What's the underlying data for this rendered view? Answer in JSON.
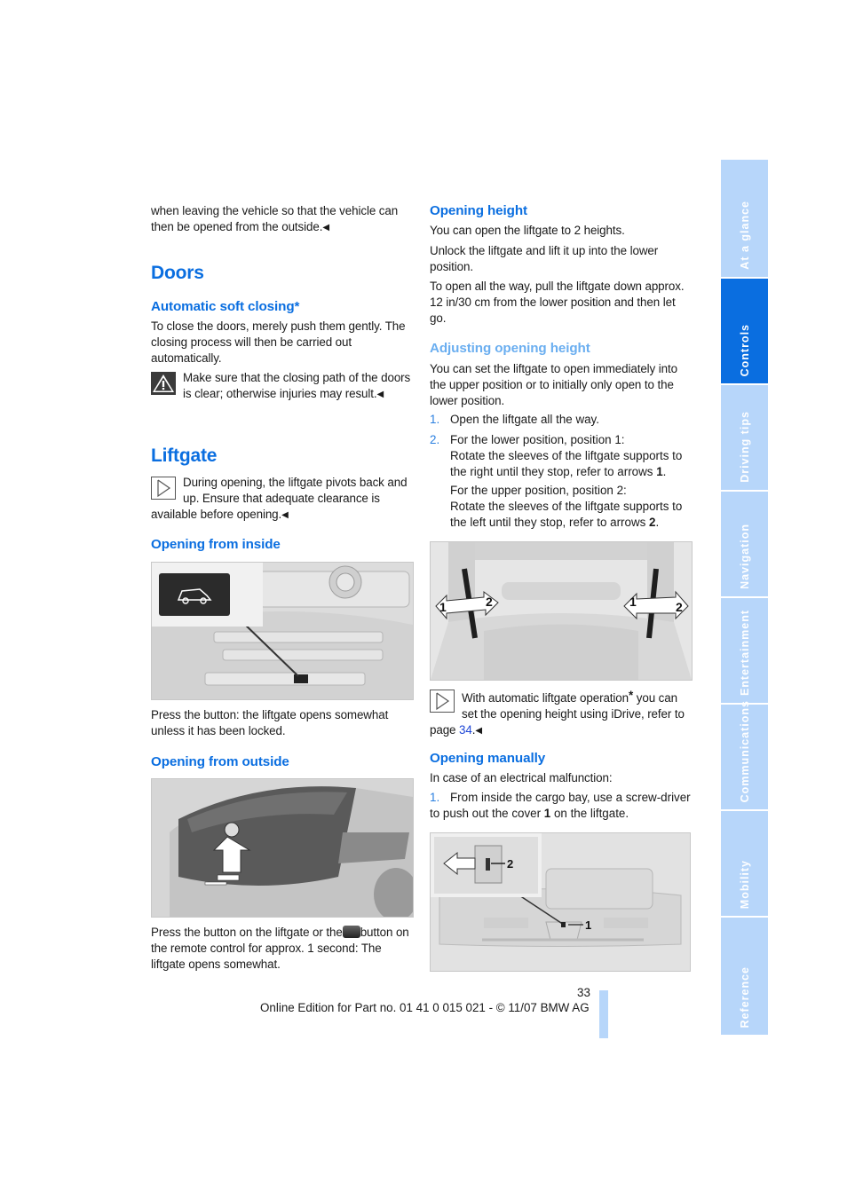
{
  "left_column": {
    "intro_text": "when leaving the vehicle so that the vehicle can then be opened from the outside.",
    "doors": {
      "title": "Doors",
      "auto_soft_closing": {
        "title": "Automatic soft closing*",
        "body": "To close the doors, merely push them gently. The closing process will then be carried out automatically.",
        "warning_icon": "warning-triangle-icon",
        "warning": "Make sure that the closing path of the doors is clear; otherwise injuries may result."
      }
    },
    "liftgate": {
      "title": "Liftgate",
      "note_icon": "note-arrow-icon",
      "note": "During opening, the liftgate pivots back and up. Ensure that adequate clearance is available before opening.",
      "opening_from_inside": {
        "title": "Opening from inside",
        "figure_alt": "Center console with liftgate button highlighted",
        "body": "Press the button: the liftgate opens somewhat unless it has been locked."
      },
      "opening_from_outside": {
        "title": "Opening from outside",
        "figure_alt": "Rear of vehicle with arrow pointing to button on liftgate",
        "body_part1": "Press the button on the liftgate or the",
        "remote_button_icon": "remote-liftgate-button-icon",
        "body_part2": "button on the remote control for approx. 1 second: The liftgate opens somewhat."
      }
    }
  },
  "right_column": {
    "opening_height": {
      "title": "Opening height",
      "p1": "You can open the liftgate to 2 heights.",
      "p2": "Unlock the liftgate and lift it up into the lower position.",
      "p3": "To open all the way, pull the liftgate down approx. 12 in/30 cm from the lower position and then let go."
    },
    "adjusting_opening_height": {
      "title": "Adjusting opening height",
      "body": "You can set the liftgate to open immediately into the upper position or to initially only open to the lower position.",
      "steps": [
        {
          "num": "1.",
          "text": "Open the liftgate all the way."
        },
        {
          "num": "2.",
          "text_a": "For the lower position, position 1:",
          "text_b": "Rotate the sleeves of the liftgate supports to the right until they stop, refer to arrows ",
          "bold_b": "1",
          "text_c": "For the upper position, position 2:",
          "text_d": "Rotate the sleeves of the liftgate supports to the left until they stop, refer to arrows ",
          "bold_d": "2"
        }
      ],
      "figure_alt": "Open liftgate with support struts and rotation arrows",
      "figure_labels": [
        "1",
        "2",
        "1",
        "2"
      ],
      "note_icon": "note-arrow-icon",
      "note_part1": "With automatic liftgate operation",
      "note_asterisk": "*",
      "note_part2": " you can set the opening height using iDrive, refer to page ",
      "note_link": "34"
    },
    "opening_manually": {
      "title": "Opening manually",
      "body": "In case of an electrical malfunction:",
      "steps": [
        {
          "num": "1.",
          "text": "From inside the cargo bay, use a screw-driver to push out the cover ",
          "bold": "1",
          "text_end": " on the liftgate."
        }
      ],
      "figure_alt": "Cargo bay liftgate cover detail",
      "figure_labels": [
        "2",
        "1"
      ]
    }
  },
  "footer": {
    "page_number": "33",
    "edition": "Online Edition for Part no. 01 41 0 015 021 - © 11/07 BMW AG"
  },
  "side_tabs": [
    {
      "label": "At a glance",
      "active": false
    },
    {
      "label": "Controls",
      "active": true
    },
    {
      "label": "Driving tips",
      "active": false
    },
    {
      "label": "Navigation",
      "active": false
    },
    {
      "label": "Entertainment",
      "active": false
    },
    {
      "label": "Communications",
      "active": false
    },
    {
      "label": "Mobility",
      "active": false
    },
    {
      "label": "Reference",
      "active": false
    }
  ],
  "colors": {
    "heading_blue": "#0a6ee0",
    "heading_light_blue": "#6aaef0",
    "tab_inactive": "#b7d6fa",
    "tab_active": "#0a6ee0",
    "link": "#1f47d6"
  }
}
